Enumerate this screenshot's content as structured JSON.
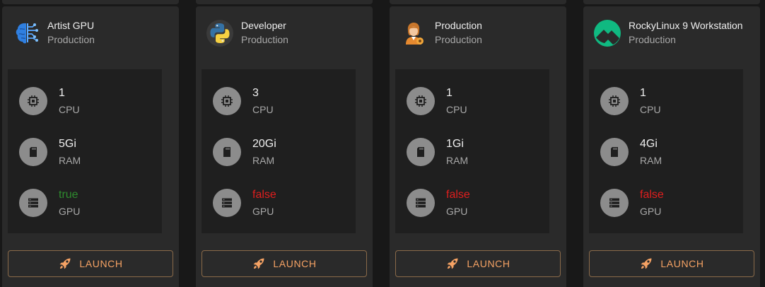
{
  "cards": [
    {
      "name": "Artist GPU",
      "environment": "Production",
      "icon": "brain-circuit-icon",
      "specs": {
        "cpu": "1",
        "cpu_label": "CPU",
        "ram": "5Gi",
        "ram_label": "RAM",
        "gpu": "true",
        "gpu_label": "GPU"
      },
      "launch_label": "LAUNCH"
    },
    {
      "name": "Developer",
      "environment": "Production",
      "icon": "python-logo-icon",
      "specs": {
        "cpu": "3",
        "cpu_label": "CPU",
        "ram": "20Gi",
        "ram_label": "RAM",
        "gpu": "false",
        "gpu_label": "GPU"
      },
      "launch_label": "LAUNCH"
    },
    {
      "name": "Production",
      "environment": "Production",
      "icon": "production-user-icon",
      "specs": {
        "cpu": "1",
        "cpu_label": "CPU",
        "ram": "1Gi",
        "ram_label": "RAM",
        "gpu": "false",
        "gpu_label": "GPU"
      },
      "launch_label": "LAUNCH"
    },
    {
      "name": "RockyLinux 9 Workstation",
      "environment": "Production",
      "icon": "rocky-linux-logo-icon",
      "specs": {
        "cpu": "1",
        "cpu_label": "CPU",
        "ram": "4Gi",
        "ram_label": "RAM",
        "gpu": "false",
        "gpu_label": "GPU"
      },
      "launch_label": "LAUNCH"
    }
  ],
  "colors": {
    "gpu_true": "#2e8b2e",
    "gpu_false": "#e01e1e",
    "accent": "#f5a264"
  },
  "spec_icons": [
    "cpu-chip-icon",
    "memory-card-icon",
    "gpu-storage-icon"
  ],
  "launch_icon": "rocket-icon"
}
